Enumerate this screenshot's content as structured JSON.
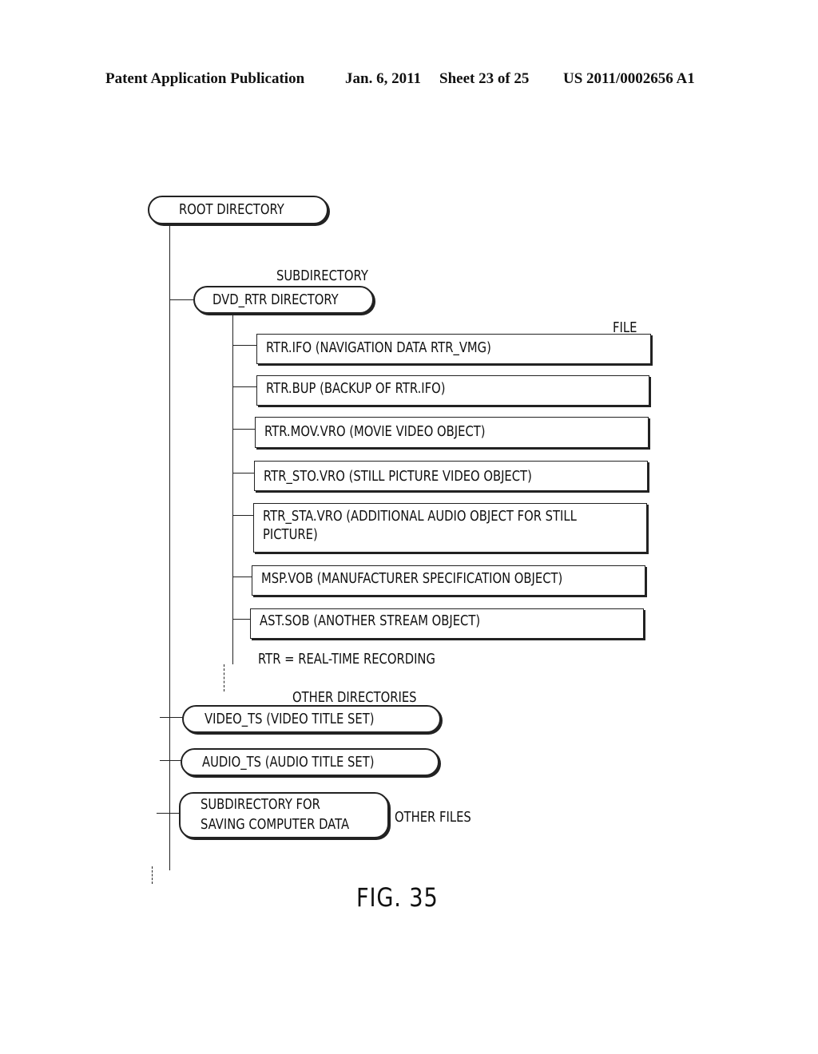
{
  "header": {
    "publication": "Patent Application Publication",
    "date": "Jan. 6, 2011",
    "sheet": "Sheet 23 of 25",
    "number": "US 2011/0002656 A1"
  },
  "diagram": {
    "root": "ROOT DIRECTORY",
    "subdirectory_label": "SUBDIRECTORY",
    "dvd_rtr": "DVD_RTR DIRECTORY",
    "file_label": "FILE",
    "files": [
      {
        "name": "RTR.IFO (NAVIGATION DATA RTR_VMG)"
      },
      {
        "name": "RTR.BUP (BACKUP OF RTR.IFO)"
      },
      {
        "name": "RTR.MOV.VRO (MOVIE VIDEO OBJECT)"
      },
      {
        "name": "RTR_STO.VRO (STILL PICTURE VIDEO OBJECT)"
      },
      {
        "name": "RTR_STA.VRO (ADDITIONAL AUDIO OBJECT FOR STILL",
        "name2": "PICTURE)"
      },
      {
        "name": "MSP.VOB (MANUFACTURER SPECIFICATION OBJECT)"
      },
      {
        "name": "AST.SOB (ANOTHER STREAM OBJECT)"
      }
    ],
    "note": "RTR = REAL-TIME RECORDING",
    "other_directories_label": "OTHER DIRECTORIES",
    "video_ts": "VIDEO_TS (VIDEO TITLE SET)",
    "audio_ts": "AUDIO_TS (AUDIO TITLE SET)",
    "computer_data_line1": "SUBDIRECTORY FOR",
    "computer_data_line2": "SAVING COMPUTER DATA",
    "other_files_label": "OTHER FILES",
    "figure_label": "FIG. 35"
  }
}
